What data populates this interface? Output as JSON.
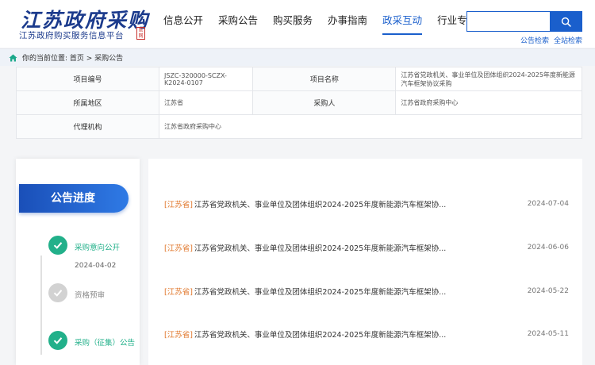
{
  "header": {
    "logo_title": "江苏政府采购",
    "logo_subtitle": "江苏政府购买服务信息平台",
    "logo_seal": "官网",
    "nav": [
      {
        "label": "信息公开",
        "active": false
      },
      {
        "label": "采购公告",
        "active": false
      },
      {
        "label": "购买服务",
        "active": false
      },
      {
        "label": "办事指南",
        "active": false
      },
      {
        "label": "政采互动",
        "active": true
      },
      {
        "label": "行业专题",
        "active": false
      }
    ],
    "search": {
      "placeholder": "",
      "icon": "search-icon"
    },
    "search_links": [
      "公告检索",
      "全站检索"
    ]
  },
  "breadcrumb": {
    "text": "你的当前位置:  首页 > 采购公告",
    "icon": "home-icon"
  },
  "info": {
    "row1": {
      "label1": "项目编号",
      "value1": "JSZC-320000-SCZX-K2024-0107",
      "label2": "项目名称",
      "value2": "江苏省党政机关、事业单位及团体组织2024-2025年度新能源汽车框架协议采购"
    },
    "row2": {
      "label1": "所属地区",
      "value1": "江苏省",
      "label2": "采购人",
      "value2": "江苏省政府采购中心"
    },
    "row3": {
      "label1": "代理机构",
      "value1": "江苏省政府采购中心"
    }
  },
  "progress": {
    "title": "公告进度",
    "steps": [
      {
        "label": "采购意向公开",
        "date": "2024-04-02",
        "status": "done"
      },
      {
        "label": "资格预审",
        "status": "todo"
      },
      {
        "label": "采购（征集）公告",
        "status": "done"
      }
    ]
  },
  "list": [
    {
      "tag": "[江苏省]",
      "title": "江苏省党政机关、事业单位及团体组织2024-2025年度新能源汽车框架协...",
      "date": "2024-07-04"
    },
    {
      "tag": "[江苏省]",
      "title": "江苏省党政机关、事业单位及团体组织2024-2025年度新能源汽车框架协...",
      "date": "2024-06-06"
    },
    {
      "tag": "[江苏省]",
      "title": "江苏省党政机关、事业单位及团体组织2024-2025年度新能源汽车框架协...",
      "date": "2024-05-22"
    },
    {
      "tag": "[江苏省]",
      "title": "江苏省党政机关、事业单位及团体组织2024-2025年度新能源汽车框架协...",
      "date": "2024-05-11"
    }
  ],
  "colors": {
    "accent": "#1a5fcc",
    "done": "#22b08a",
    "tag": "#e0762a"
  }
}
